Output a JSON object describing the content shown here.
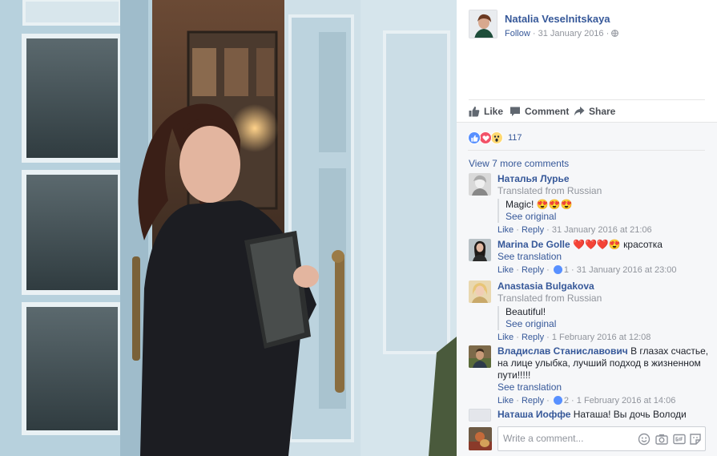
{
  "post": {
    "author": "Natalia Veselnitskaya",
    "follow_label": "Follow",
    "date": "31 January 2016",
    "audience_icon": "globe-icon"
  },
  "actions": {
    "like": "Like",
    "comment": "Comment",
    "share": "Share"
  },
  "reactions": {
    "types": [
      "like",
      "love",
      "wow"
    ],
    "count": "117"
  },
  "view_more": "View 7 more comments",
  "comments": [
    {
      "name": "Наталья Лурье",
      "translated_note": "Translated from Russian",
      "text": "Magic! 😍😍😍",
      "see_link": "See original",
      "like": "Like",
      "reply": "Reply",
      "date": "31 January 2016 at 21:06"
    },
    {
      "name": "Marina De Golle",
      "text": "❤️❤️❤️😍 красотка",
      "see_link": "See translation",
      "like": "Like",
      "reply": "Reply",
      "likes": "1",
      "date": "31 January 2016 at 23:00"
    },
    {
      "name": "Anastasia Bulgakova",
      "translated_note": "Translated from Russian",
      "text": "Beautiful!",
      "see_link": "See original",
      "like": "Like",
      "reply": "Reply",
      "date": "1 February 2016 at 12:08"
    },
    {
      "name": "Владислав Станиславович",
      "text": "В глазах счастье, на лице улыбка, лучший подход в жизненном пути!!!!!",
      "see_link": "See translation",
      "like": "Like",
      "reply": "Reply",
      "likes": "2",
      "date": "1 February 2016 at 14:06"
    },
    {
      "name": "Наташа Иоффе",
      "text": "Наташа! Вы дочь Володи"
    }
  ],
  "composer": {
    "placeholder": "Write a comment...",
    "tools": [
      "emoji-icon",
      "camera-icon",
      "gif-icon",
      "sticker-icon"
    ]
  },
  "colors": {
    "link": "#365899",
    "muted": "#90949c",
    "like_blue": "#5890ff",
    "love_red": "#f25268",
    "wow_yellow": "#ffd972"
  }
}
